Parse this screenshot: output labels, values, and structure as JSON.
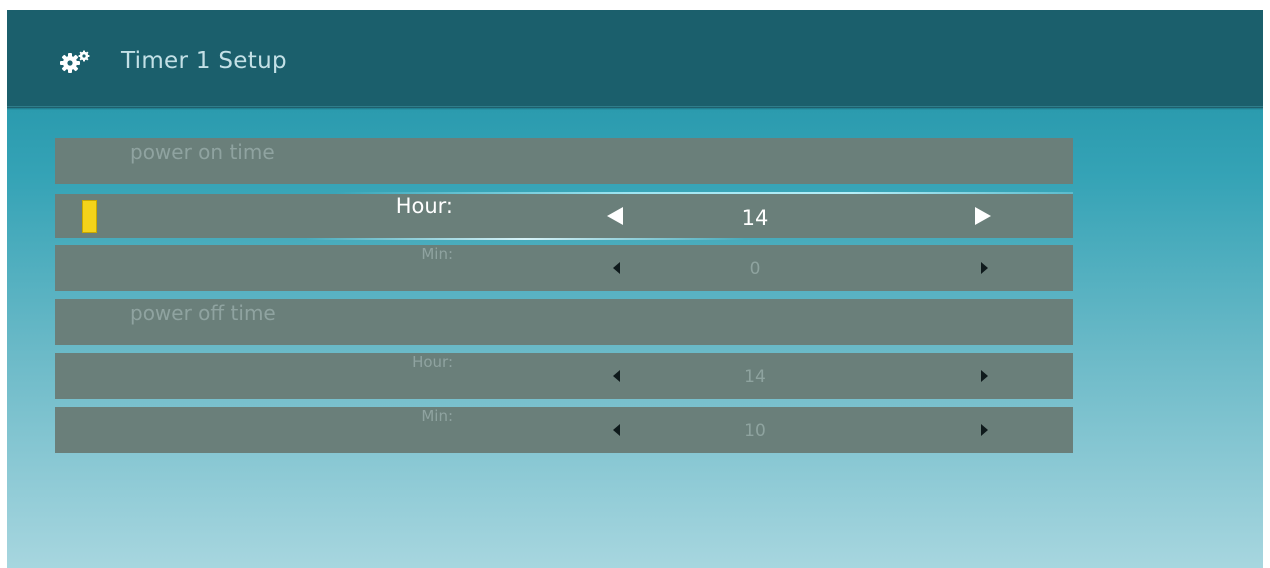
{
  "header": {
    "title": "Timer 1 Setup",
    "icon": "gear-icon"
  },
  "timer": {
    "power_on": {
      "section_label": "power on time",
      "hour": {
        "label": "Hour:",
        "value": "14"
      },
      "min": {
        "label": "Min:",
        "value": "0"
      }
    },
    "power_off": {
      "section_label": "power off time",
      "hour": {
        "label": "Hour:",
        "value": "14"
      },
      "min": {
        "label": "Min:",
        "value": "10"
      }
    }
  },
  "colors": {
    "header_bg": "#1b5f6c",
    "row_bg": "#6a7f7a",
    "focus_cursor": "#f4d31a",
    "active_text": "#ffffff",
    "inactive_text": "#8fa3a0"
  }
}
